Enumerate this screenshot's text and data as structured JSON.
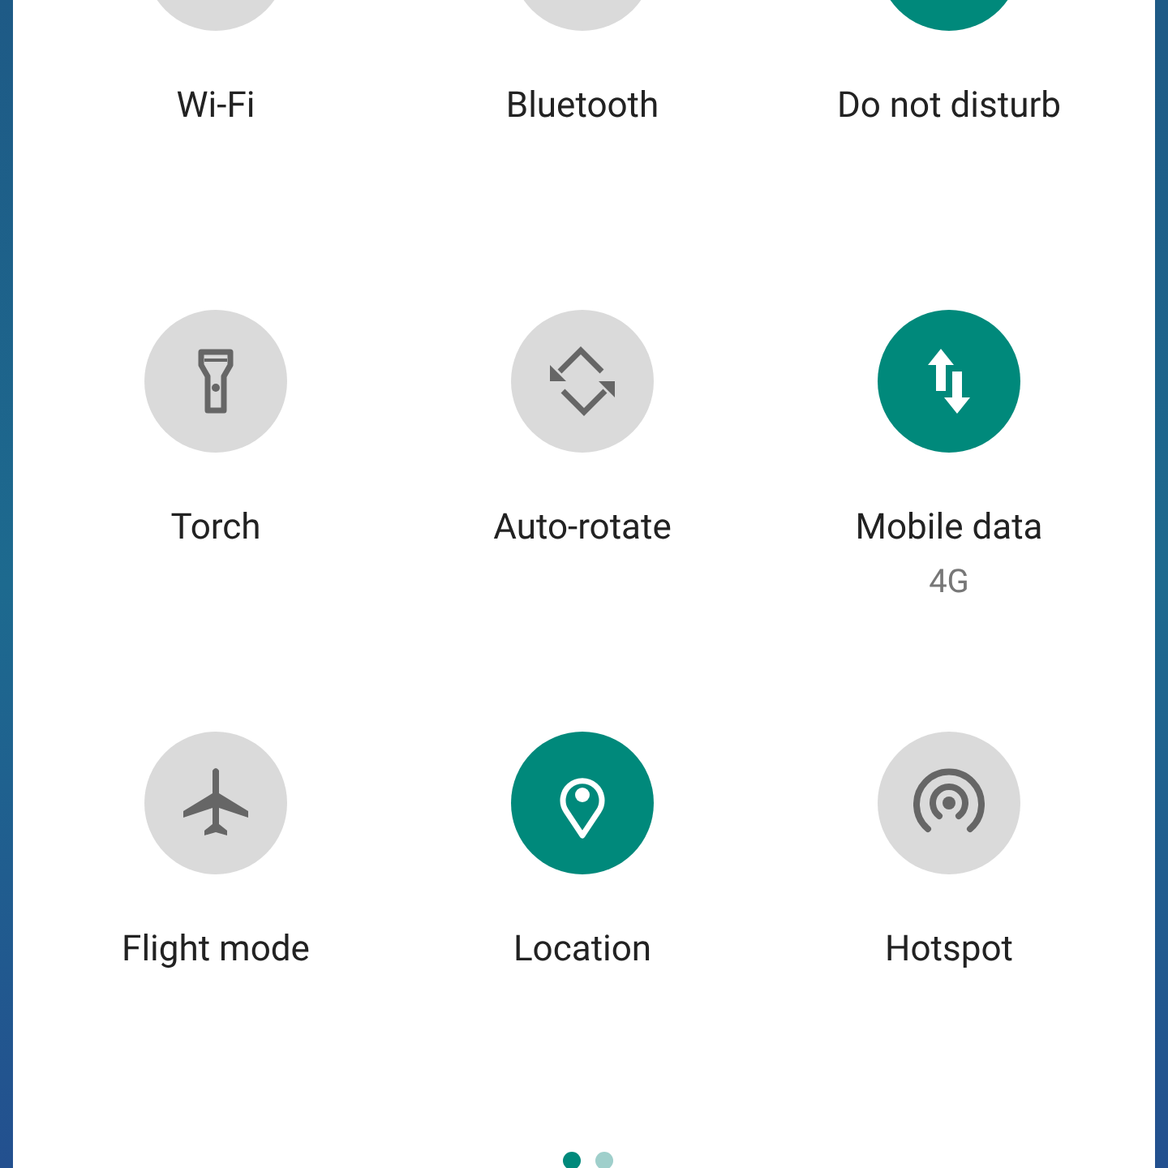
{
  "tiles": [
    {
      "label": "Wi-Fi",
      "on": false
    },
    {
      "label": "Bluetooth",
      "on": false
    },
    {
      "label": "Do not disturb",
      "on": true
    },
    {
      "label": "Torch",
      "on": false
    },
    {
      "label": "Auto-rotate",
      "on": false
    },
    {
      "label": "Mobile data",
      "sublabel": "4G",
      "on": true
    },
    {
      "label": "Flight mode",
      "on": false
    },
    {
      "label": "Location",
      "on": true
    },
    {
      "label": "Hotspot",
      "on": false
    }
  ],
  "pages": [
    {
      "selected": true
    },
    {
      "selected": false
    }
  ]
}
